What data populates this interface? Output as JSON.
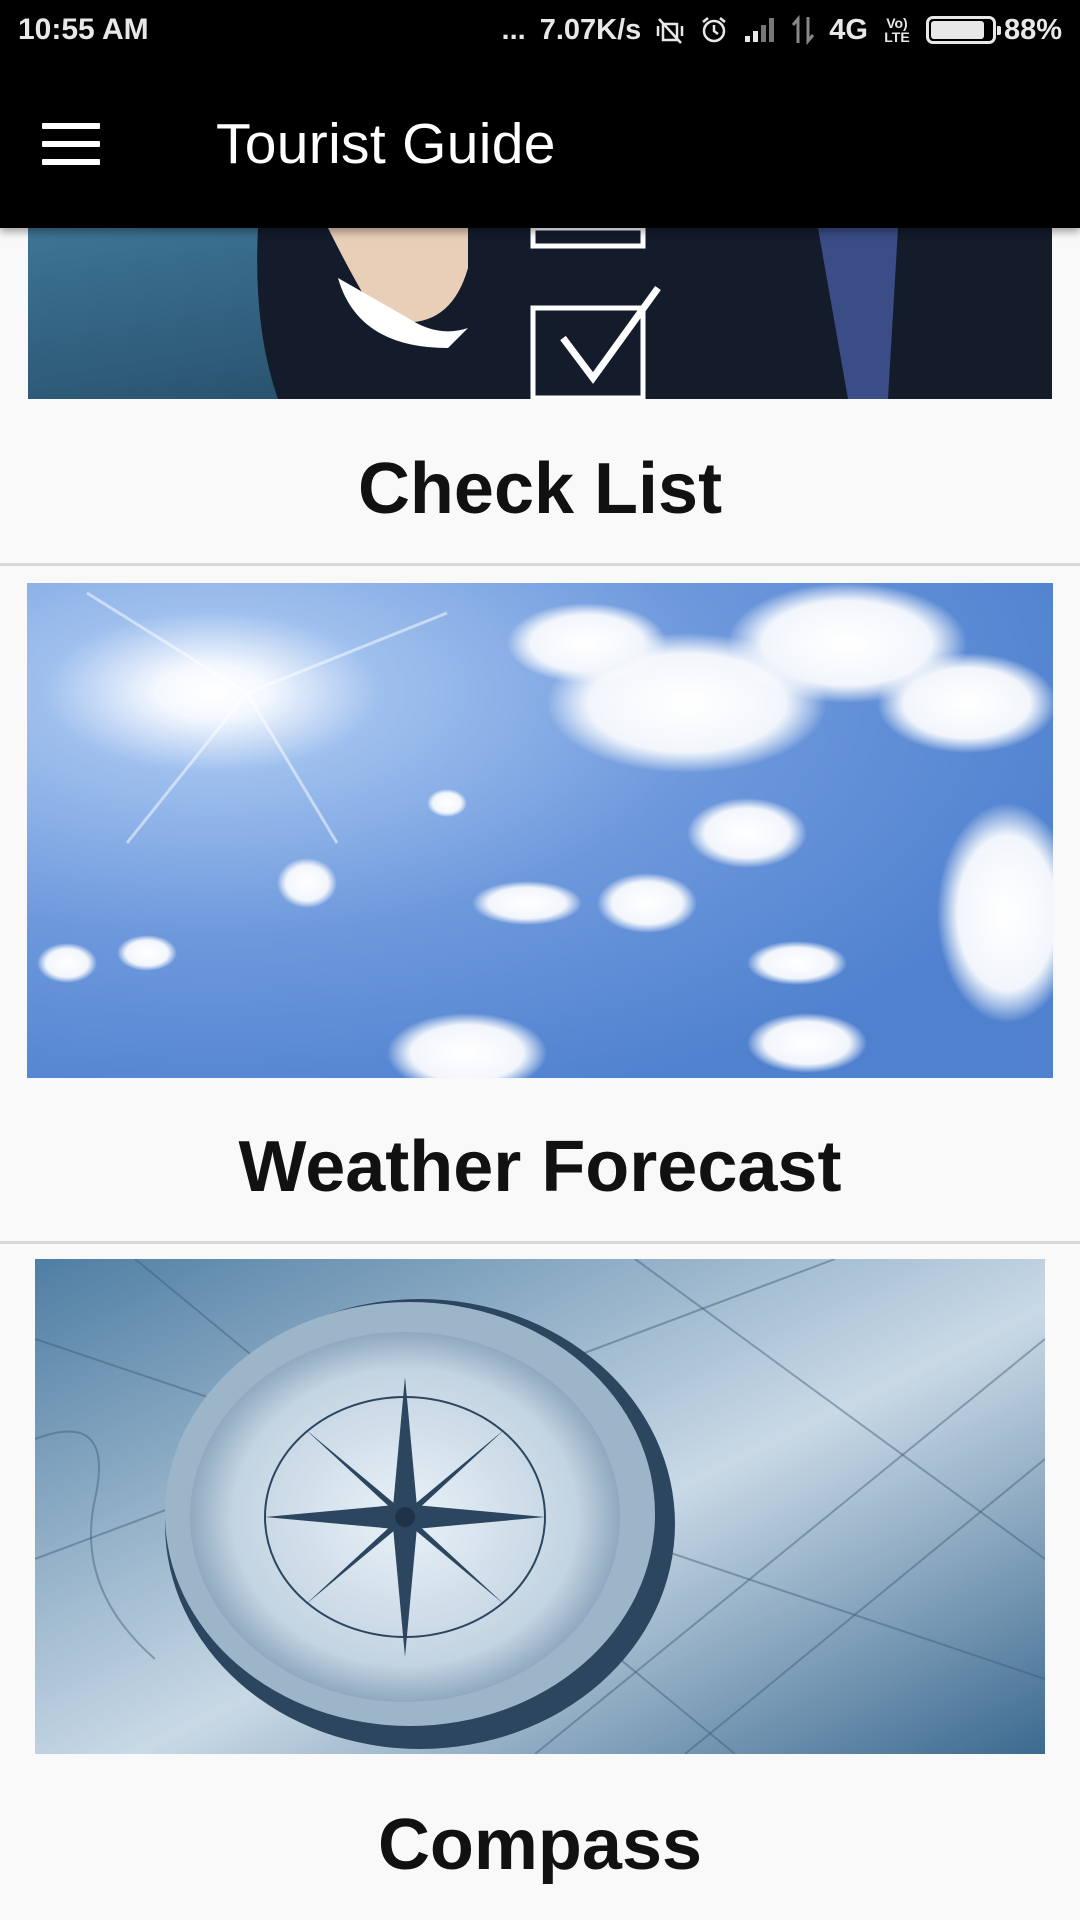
{
  "status_bar": {
    "time": "10:55 AM",
    "dots": "...",
    "speed": "7.07K/s",
    "network": "4G",
    "volte": "Vo LTE",
    "battery": "88%",
    "battery_level": 0.88
  },
  "app_bar": {
    "menu_icon": "hamburger-menu-icon",
    "title": "Tourist Guide"
  },
  "items": [
    {
      "label": "Check List",
      "image": "businessman-checklist-photo"
    },
    {
      "label": "Weather Forecast",
      "image": "sunny-sky-clouds-photo"
    },
    {
      "label": "Compass",
      "image": "compass-on-map-photo"
    }
  ],
  "colors": {
    "bar_background": "#000000",
    "page_background": "#f9f9f9",
    "divider": "#d8d8d8"
  }
}
